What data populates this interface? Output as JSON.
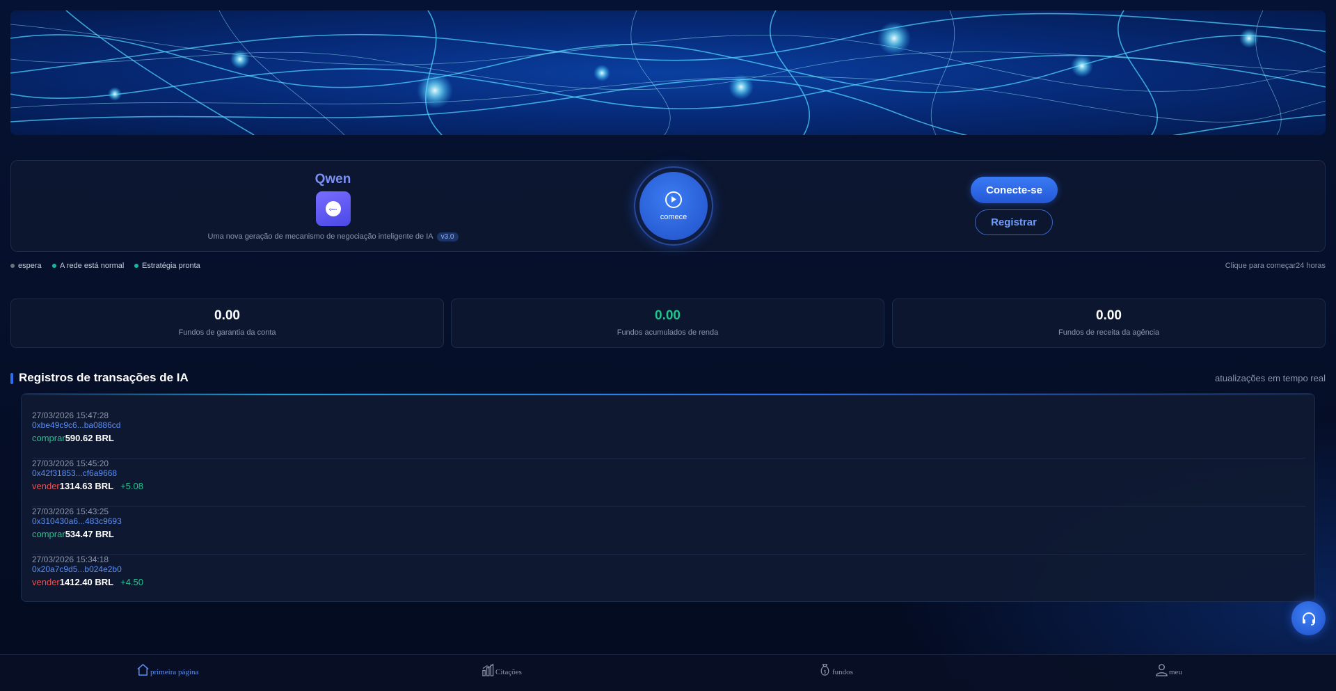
{
  "brand": {
    "name": "Qwen",
    "logo_text": "Qwen",
    "subtitle": "Uma nova geração de mecanismo de negociação inteligente de IA",
    "version": "v3.0"
  },
  "start_button": {
    "label": "comece"
  },
  "auth": {
    "connect_label": "Conecte-se",
    "register_label": "Registrar"
  },
  "status": {
    "items": [
      {
        "label": "espera",
        "color": "#6b7280"
      },
      {
        "label": "A rede está normal",
        "color": "#14b8a6"
      },
      {
        "label": "Estratégia pronta",
        "color": "#14b8a6"
      }
    ],
    "right_text": "Clique para começar24 horas"
  },
  "stats": [
    {
      "value": "0.00",
      "label": "Fundos de garantia da conta",
      "highlight": false
    },
    {
      "value": "0.00",
      "label": "Fundos acumulados de renda",
      "highlight": true
    },
    {
      "value": "0.00",
      "label": "Fundos de receita da agência",
      "highlight": false
    }
  ],
  "records_section": {
    "title": "Registros de transações de IA",
    "right_text": "atualizações em tempo real",
    "records": [
      {
        "time": "27/03/2026 15:47:28",
        "hash": "0xbe49c9c6...ba0886cd",
        "side": "comprar",
        "amount": "590.62 BRL",
        "profit": ""
      },
      {
        "time": "27/03/2026 15:45:20",
        "hash": "0x42f31853...cf6a9668",
        "side": "vender",
        "amount": "1314.63 BRL",
        "profit": "+5.08"
      },
      {
        "time": "27/03/2026 15:43:25",
        "hash": "0x310430a6...483c9693",
        "side": "comprar",
        "amount": "534.47 BRL",
        "profit": ""
      },
      {
        "time": "27/03/2026 15:34:18",
        "hash": "0x20a7c9d5...b024e2b0",
        "side": "vender",
        "amount": "1412.40 BRL",
        "profit": "+4.50"
      }
    ]
  },
  "nav": {
    "items": [
      {
        "label": "primeira página",
        "icon": "home-icon",
        "active": true
      },
      {
        "label": "Citações",
        "icon": "chart-bars-icon",
        "active": false
      },
      {
        "label": "fundos",
        "icon": "money-bag-icon",
        "active": false
      },
      {
        "label": "meu",
        "icon": "user-icon",
        "active": false
      }
    ]
  },
  "colors": {
    "accent": "#2f6ef0",
    "buy": "#22c38e",
    "sell": "#f05050",
    "background": "#061233"
  }
}
